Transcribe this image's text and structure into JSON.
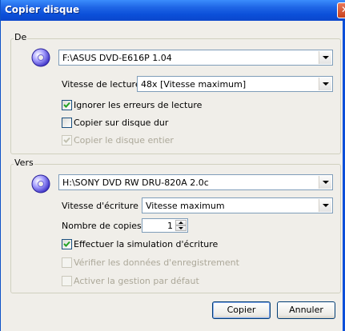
{
  "window": {
    "title": "Copier disque",
    "close_glyph": "✕"
  },
  "source": {
    "group_label": "De",
    "icon": "disc-icon",
    "drive": "F:\\ASUS DVD-E616P 1.04",
    "speed_label": "Vitesse de lecture :",
    "speed_value": "48x [Vitesse maximum]",
    "options": [
      {
        "label": "Ignorer les erreurs de lecture",
        "checked": true,
        "enabled": true
      },
      {
        "label": "Copier sur disque dur",
        "checked": false,
        "enabled": true
      },
      {
        "label": "Copier le disque entier",
        "checked": true,
        "enabled": false
      }
    ]
  },
  "target": {
    "group_label": "Vers",
    "icon": "disc-icon",
    "drive": "H:\\SONY DVD RW DRU-820A 2.0c",
    "speed_label": "Vitesse d'écriture :",
    "speed_value": "Vitesse maximum",
    "copies_label": "Nombre de copies :",
    "copies_value": "1",
    "options": [
      {
        "label": "Effectuer la simulation d'écriture",
        "checked": true,
        "enabled": true
      },
      {
        "label": "Vérifier les données d'enregistrement",
        "checked": false,
        "enabled": false
      },
      {
        "label": "Activer la gestion par défaut",
        "checked": false,
        "enabled": false
      }
    ]
  },
  "buttons": {
    "ok": "Copier",
    "cancel": "Annuler"
  },
  "colors": {
    "title_bar": "#0b4fd9",
    "dialog_bg": "#f0eee9",
    "disabled_text": "#aca899"
  }
}
